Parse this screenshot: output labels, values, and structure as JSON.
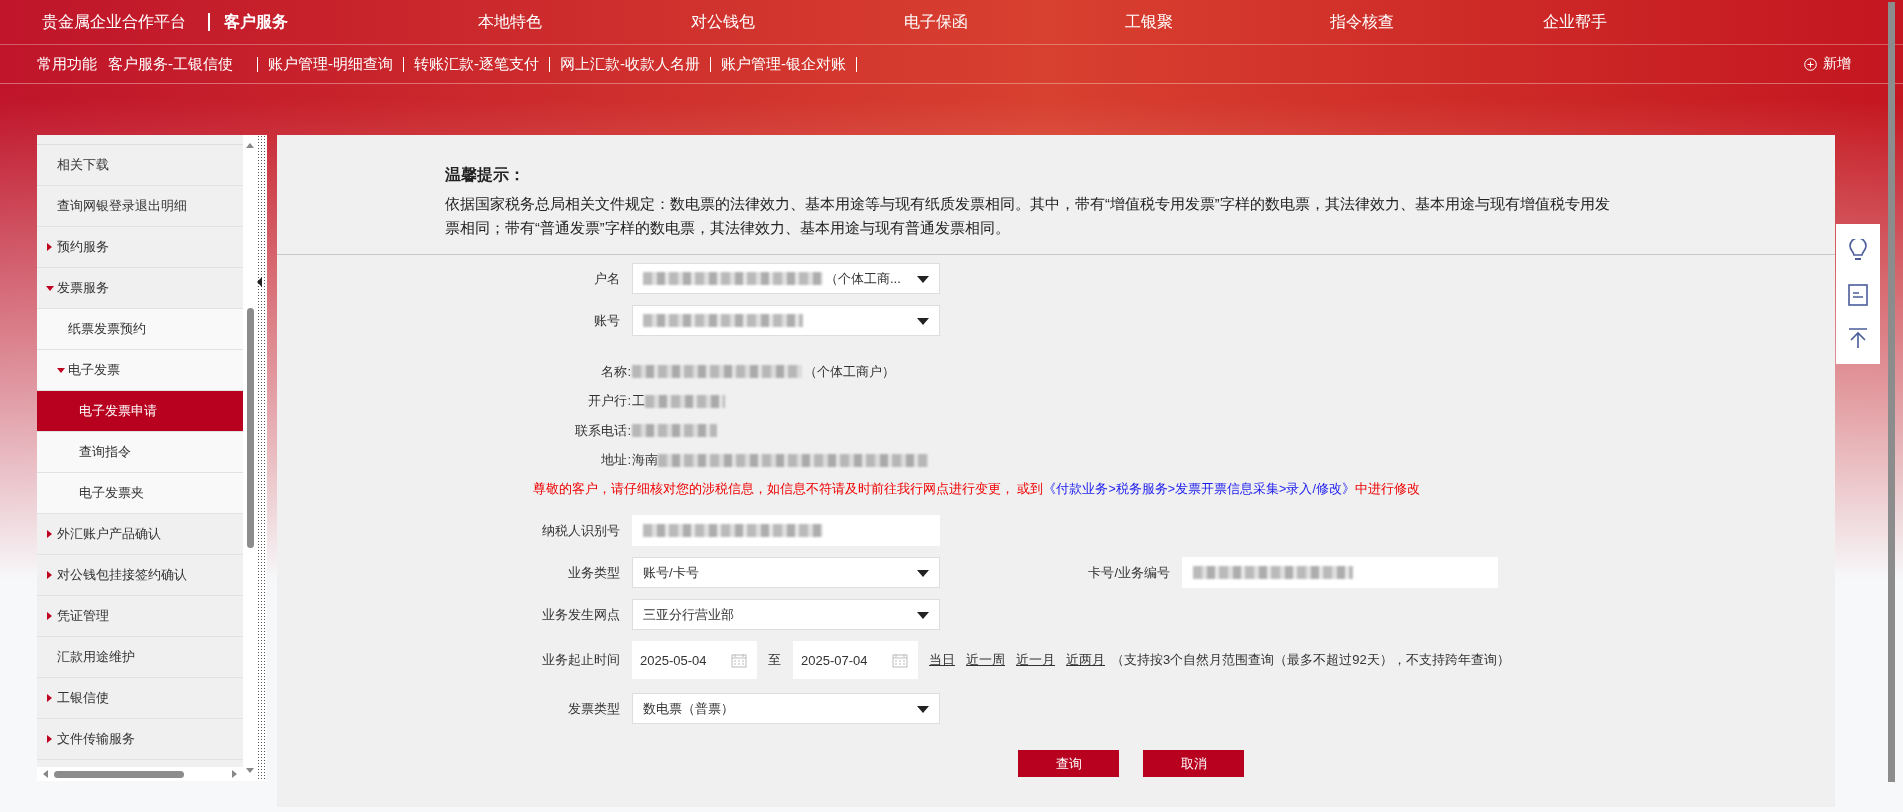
{
  "top_nav": {
    "brand": "贵金属企业合作平台",
    "items": [
      {
        "label": "客户服务",
        "selected": true
      },
      {
        "label": "本地特色",
        "selected": false
      },
      {
        "label": "对公钱包",
        "selected": false
      },
      {
        "label": "电子保函",
        "selected": false
      },
      {
        "label": "工银聚",
        "selected": false
      },
      {
        "label": "指令核查",
        "selected": false
      },
      {
        "label": "企业帮手",
        "selected": false
      }
    ]
  },
  "shortcut_bar": {
    "title": "常用功能",
    "items": [
      {
        "label": "客户服务-工银信使",
        "divider": false
      },
      {
        "label": "账户管理-明细查询",
        "divider": true
      },
      {
        "label": "转账汇款-逐笔支付",
        "divider": true
      },
      {
        "label": "网上汇款-收款人名册",
        "divider": true
      },
      {
        "label": "账户管理-银企对账",
        "divider": true
      }
    ],
    "add_button": "新增"
  },
  "sidebar": {
    "items": [
      {
        "label": "相关下载",
        "selected": false
      },
      {
        "label": "查询网银登录退出明细",
        "selected": false
      },
      {
        "label": "预约服务",
        "expanded": false,
        "selected": false
      },
      {
        "label": "发票服务",
        "expanded": true,
        "selected": false,
        "children": [
          {
            "label": "纸票发票预约",
            "selected": false
          },
          {
            "label": "电子发票",
            "expanded": true,
            "selected": false,
            "children": [
              {
                "label": "电子发票申请",
                "selected": true
              },
              {
                "label": "查询指令",
                "selected": false
              },
              {
                "label": "电子发票夹",
                "selected": false
              }
            ]
          }
        ]
      },
      {
        "label": "外汇账户产品确认",
        "expanded": false,
        "selected": false
      },
      {
        "label": "对公钱包挂接签约确认",
        "expanded": false,
        "selected": false
      },
      {
        "label": "凭证管理",
        "expanded": false,
        "selected": false
      },
      {
        "label": "汇款用途维护",
        "selected": false
      },
      {
        "label": "工银信使",
        "expanded": false,
        "selected": false
      },
      {
        "label": "文件传输服务",
        "expanded": false,
        "selected": false
      }
    ]
  },
  "notice": {
    "title": "温馨提示：",
    "text": "依据国家税务总局相关文件规定：数电票的法律效力、基本用途等与现有纸质发票相同。其中，带有“增值税专用发票”字样的数电票，其法律效力、基本用途与现有增值税专用发票相同；带有“普通发票”字样的数电票，其法律效力、基本用途与现有普通发票相同。"
  },
  "account": {
    "name_label": "户名",
    "name_value": "（个体工商...",
    "name_blurred": true,
    "number_label": "账号",
    "number_blurred": true
  },
  "info": [
    {
      "label": "名称:",
      "blurred": true,
      "suffix": "（个体工商户）"
    },
    {
      "label": "开户行:",
      "prefix": "工",
      "blurred": true
    },
    {
      "label": "联系电话:",
      "blurred": true
    },
    {
      "label": "地址:",
      "prefix": "海南",
      "blurred": true
    }
  ],
  "warning": {
    "text": "尊敬的客户，请仔细核对您的涉税信息，如信息不符请及时前往我行网点进行变更， 或到",
    "link": "《付款业务>税务服务>发票开票信息采集>录入/修改》",
    "tail": "中进行修改"
  },
  "form": {
    "taxpayer_label": "纳税人识别号",
    "taxpayer_blurred": true,
    "business_type_label": "业务类型",
    "business_type": "账号/卡号",
    "card_label": "卡号/业务编号",
    "card_blurred": true,
    "branch_label": "业务发生网点",
    "branch": "三亚分行营业部",
    "period_label": "业务起止时间",
    "start_date": "2025-05-04",
    "to": "至",
    "end_date": "2025-07-04",
    "quick_ranges": [
      "当日",
      "近一周",
      "近一月",
      "近两月"
    ],
    "period_note": "（支持按3个自然月范围查询（最多不超过92天），不支持跨年查询）",
    "invoice_type_label": "发票类型",
    "invoice_type": "数电票（普票）"
  },
  "buttons": [
    "查询",
    "取消"
  ]
}
